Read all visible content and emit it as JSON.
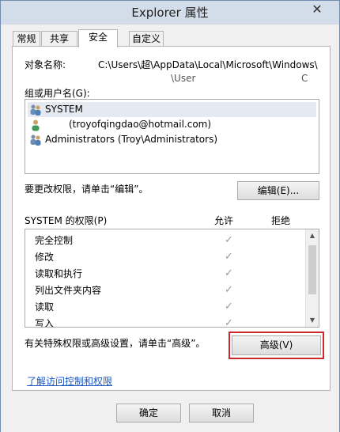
{
  "window": {
    "title": "Explorer 属性",
    "close_glyph": "✕"
  },
  "tabs": [
    "常规",
    "共享",
    "安全",
    "自定义"
  ],
  "object": {
    "label": "对象名称:",
    "path_line1": "C:\\Users\\超\\AppData\\Local\\Microsoft\\Windows\\",
    "path_line2": "\\User",
    "path_line3": "C"
  },
  "groups": {
    "label": "组或用户名(G):",
    "users": [
      {
        "name": "SYSTEM",
        "icon": "group-users-icon",
        "selected": true
      },
      {
        "name": "(troyofqingdao@hotmail.com)",
        "icon": "user-icon",
        "selected": false
      },
      {
        "name": "Administrators (Troy\\Administrators)",
        "icon": "group-users-icon",
        "selected": false
      }
    ]
  },
  "edit": {
    "hint": "要更改权限，请单击“编辑”。",
    "button_label": "编辑(E)..."
  },
  "permissions": {
    "header": "SYSTEM 的权限(P)",
    "allow_label": "允许",
    "deny_label": "拒绝",
    "check_glyph": "✓",
    "items": [
      {
        "name": "完全控制",
        "allow": true
      },
      {
        "name": "修改",
        "allow": true
      },
      {
        "name": "读取和执行",
        "allow": true
      },
      {
        "name": "列出文件夹内容",
        "allow": true
      },
      {
        "name": "读取",
        "allow": true
      },
      {
        "name": "写入",
        "allow": true
      }
    ]
  },
  "advanced": {
    "hint": "有关特殊权限或高级设置，请单击“高级”。",
    "button_label": "高级(V)"
  },
  "link": {
    "label": "了解访问控制和权限"
  },
  "footer": {
    "ok_label": "确定",
    "cancel_label": "取消"
  },
  "colors": {
    "highlight_border": "#cc2a2a",
    "link": "#1a56c4",
    "selected_row": "#e5eaf2"
  }
}
